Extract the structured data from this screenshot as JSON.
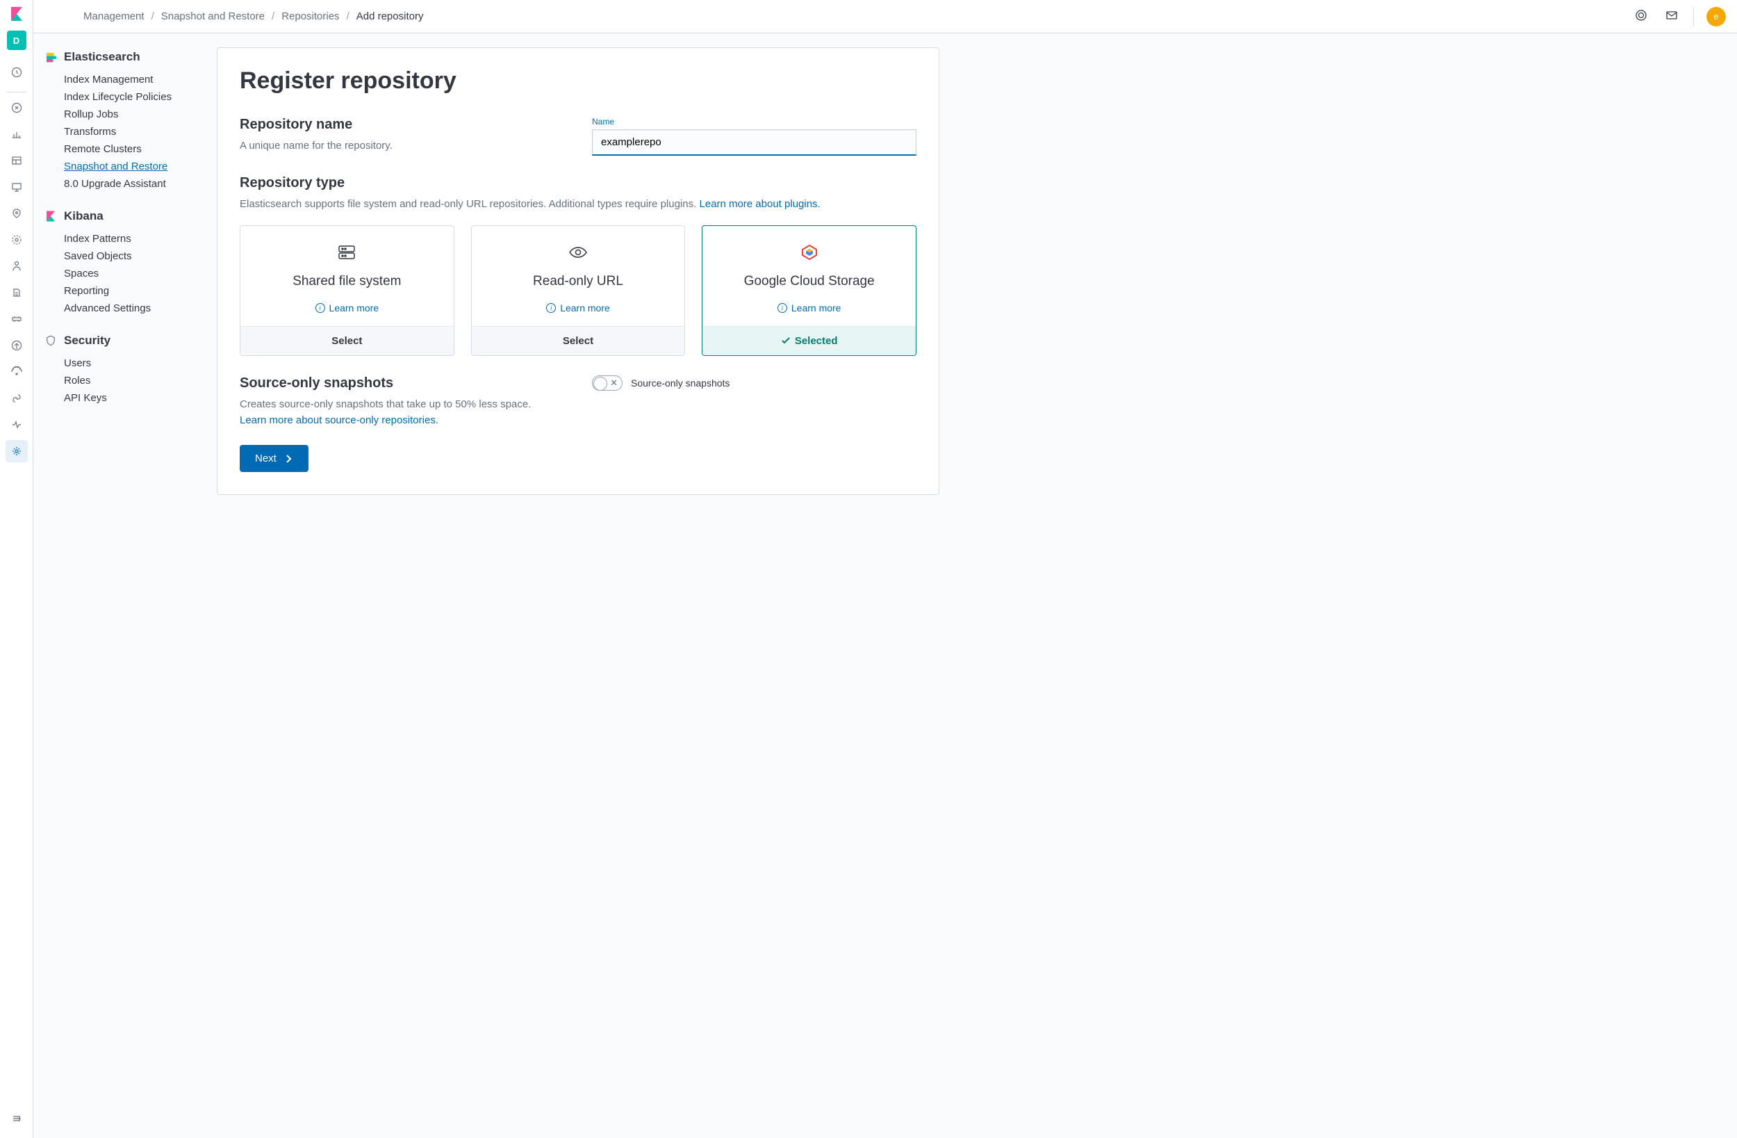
{
  "header": {
    "space_letter": "D",
    "breadcrumb": [
      "Management",
      "Snapshot and Restore",
      "Repositories",
      "Add repository"
    ],
    "avatar_letter": "e"
  },
  "sidebar": {
    "sections": [
      {
        "title": "Elasticsearch",
        "items": [
          "Index Management",
          "Index Lifecycle Policies",
          "Rollup Jobs",
          "Transforms",
          "Remote Clusters",
          "Snapshot and Restore",
          "8.0 Upgrade Assistant"
        ],
        "active_index": 5
      },
      {
        "title": "Kibana",
        "items": [
          "Index Patterns",
          "Saved Objects",
          "Spaces",
          "Reporting",
          "Advanced Settings"
        ]
      },
      {
        "title": "Security",
        "items": [
          "Users",
          "Roles",
          "API Keys"
        ]
      }
    ]
  },
  "page": {
    "title": "Register repository",
    "repo_name": {
      "heading": "Repository name",
      "desc": "A unique name for the repository.",
      "label": "Name",
      "value": "examplerepo"
    },
    "repo_type": {
      "heading": "Repository type",
      "desc_prefix": "Elasticsearch supports file system and read-only URL repositories. Additional types require plugins. ",
      "learn_link": "Learn more about plugins.",
      "cards": [
        {
          "title": "Shared file system",
          "learn": "Learn more",
          "foot": "Select",
          "selected": false
        },
        {
          "title": "Read-only URL",
          "learn": "Learn more",
          "foot": "Select",
          "selected": false
        },
        {
          "title": "Google Cloud Storage",
          "learn": "Learn more",
          "foot": "Selected",
          "selected": true
        }
      ]
    },
    "source_only": {
      "heading": "Source-only snapshots",
      "desc": "Creates source-only snapshots that take up to 50% less space.",
      "learn_link": "Learn more about source-only repositories.",
      "switch_label": "Source-only snapshots"
    },
    "next_button": "Next"
  }
}
